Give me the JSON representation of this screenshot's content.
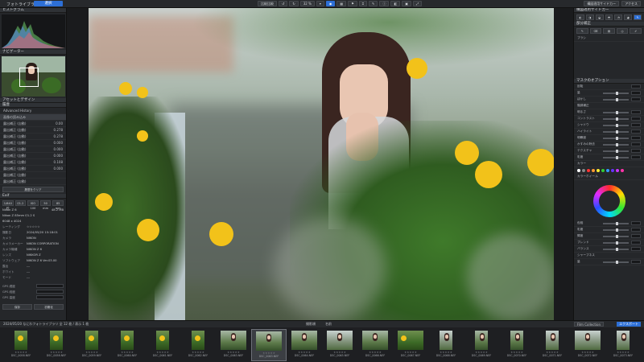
{
  "app": {
    "title": "フォトライブラリ",
    "active_tab": "選択"
  },
  "toolbar": {
    "left_buttons": [
      "比較比較",
      "比較",
      "1:1"
    ],
    "zoom": "32 %",
    "right_buttons": [
      "構図適用サイドカー",
      "アクセス"
    ]
  },
  "left_panel": {
    "histogram_header": "ヒストグラム",
    "navigator_header": "ナビゲーター",
    "assets_header": "アセットとデザイン",
    "history_header": "履歴",
    "advanced_history_label": "Advanced History",
    "history_items": [
      {
        "label": "画像の読み込み",
        "value": ""
      },
      {
        "label": "露出補正 (自動)",
        "value": "0.00"
      },
      {
        "label": "露出補正 (自動)",
        "value": "0.278"
      },
      {
        "label": "露出補正 (自動)",
        "value": "0.278"
      },
      {
        "label": "露出補正 (自動)",
        "value": "0.000"
      },
      {
        "label": "露出補正 (自動)",
        "value": "0.000"
      },
      {
        "label": "露出補正 (自動)",
        "value": "0.000"
      },
      {
        "label": "露出補正 (自動)",
        "value": "0.108"
      },
      {
        "label": "露出補正 (自動)",
        "value": "0.000"
      },
      {
        "label": "露出補正 (自動)",
        "value": ""
      },
      {
        "label": "露出補正 (自動)",
        "value": ""
      }
    ],
    "history_clear_label": "履歴をクリア",
    "exif_header": "Exif",
    "lens_buttons": [
      "1/640 秒",
      "f/1.2",
      "ISO 100",
      "50 mm",
      "85 mm"
    ],
    "camera_line": "Nikon Z 6",
    "lens_line": "Nikon Z 85mm f/1.2 S",
    "size_line": "6048 x 4024",
    "file_size": "48.2 MB",
    "exif_rows": [
      {
        "key": "レーティング",
        "value": "☆☆☆☆☆"
      },
      {
        "key": "撮影日",
        "value": "2024/05/20 15:18:01"
      },
      {
        "key": "カメラ",
        "value": "NIKON"
      },
      {
        "key": "カメラメーカー",
        "value": "NIKON CORPORATION"
      },
      {
        "key": "カメラ機種",
        "value": "NIKON Z 6"
      },
      {
        "key": "レンズ",
        "value": "NIKKOR Z"
      },
      {
        "key": "ソフトウェア",
        "value": "NIKON Z 6 Ver.03.00"
      },
      {
        "key": "露出",
        "value": "---"
      },
      {
        "key": "ホワイト",
        "value": "---"
      },
      {
        "key": "モード",
        "value": "---"
      }
    ],
    "gps_labels": [
      "GPS 緯度",
      "GPS 経度",
      "GPS 高度"
    ],
    "bottom_buttons": [
      "保存",
      "初期化"
    ]
  },
  "right_panel": {
    "header": "構図適用サイドカー",
    "adjust_header": "部分補正",
    "tools": [
      "ブラシ"
    ],
    "section1": "マスクのオプション",
    "rows": [
      "反転",
      "量",
      "ぼかし",
      "階調補正",
      "明るさ",
      "コントラスト",
      "シャドウ",
      "ハイライト",
      "明瞭度",
      "かすみの除去",
      "テクスチャ",
      "彩度",
      "カラー"
    ],
    "section_color": "カラーホイール",
    "rows2": [
      "色相",
      "彩度",
      "輝度",
      "ブレンド",
      "バランス"
    ],
    "section_sharp": "シャープネス",
    "rows3": [
      "量"
    ],
    "swatch_colors": [
      "#ffffff",
      "#888888",
      "#ff3333",
      "#ff9933",
      "#ffee33",
      "#33cc33",
      "#3399ff",
      "#6633ff",
      "#cc33ff",
      "#ff33aa"
    ]
  },
  "viewer": {
    "bg_sky": "#bfc9c4",
    "flower": "#f2c21a",
    "leaf": "#3f7a2a"
  },
  "filmstrip": {
    "header_left": "2024/05/20 なにわフォトライブラリ 全 12 枚 / 表示 1 枚",
    "header_center_a": "撮影順",
    "header_center_b": "名前",
    "right_buttons": [
      "Film Collection",
      "エクスポート"
    ],
    "items": [
      {
        "name": "DSC_0058.NEF",
        "orient": "p",
        "scheme": "y"
      },
      {
        "name": "DSC_0058.NEF",
        "orient": "p",
        "scheme": "y"
      },
      {
        "name": "DSC_0059.NEF",
        "orient": "p",
        "scheme": "y"
      },
      {
        "name": "DSC_0060.NEF",
        "orient": "p",
        "scheme": "y"
      },
      {
        "name": "DSC_0061.NEF",
        "orient": "p",
        "scheme": "y"
      },
      {
        "name": "DSC_0062.NEF",
        "orient": "p",
        "scheme": "y"
      },
      {
        "name": "DSC_0063.NEF",
        "orient": "l",
        "scheme": "g"
      },
      {
        "name": "DSC_0063.NEF",
        "orient": "l",
        "scheme": "g"
      },
      {
        "name": "DSC_0064.NEF",
        "orient": "l",
        "scheme": "g"
      },
      {
        "name": "DSC_0065.NEF",
        "orient": "l",
        "scheme": "f"
      },
      {
        "name": "DSC_0066.NEF",
        "orient": "l",
        "scheme": "g"
      },
      {
        "name": "DSC_0067.NEF",
        "orient": "l",
        "scheme": "y"
      },
      {
        "name": "DSC_0068.NEF",
        "orient": "p",
        "scheme": "f"
      },
      {
        "name": "DSC_0069.NEF",
        "orient": "p",
        "scheme": "g"
      },
      {
        "name": "DSC_0070.NEF",
        "orient": "p",
        "scheme": "g"
      },
      {
        "name": "DSC_0071.NEF",
        "orient": "p",
        "scheme": "f"
      },
      {
        "name": "DSC_0072.NEF",
        "orient": "l",
        "scheme": "f"
      },
      {
        "name": "DSC_0073.NEF",
        "orient": "p",
        "scheme": "f"
      }
    ]
  }
}
